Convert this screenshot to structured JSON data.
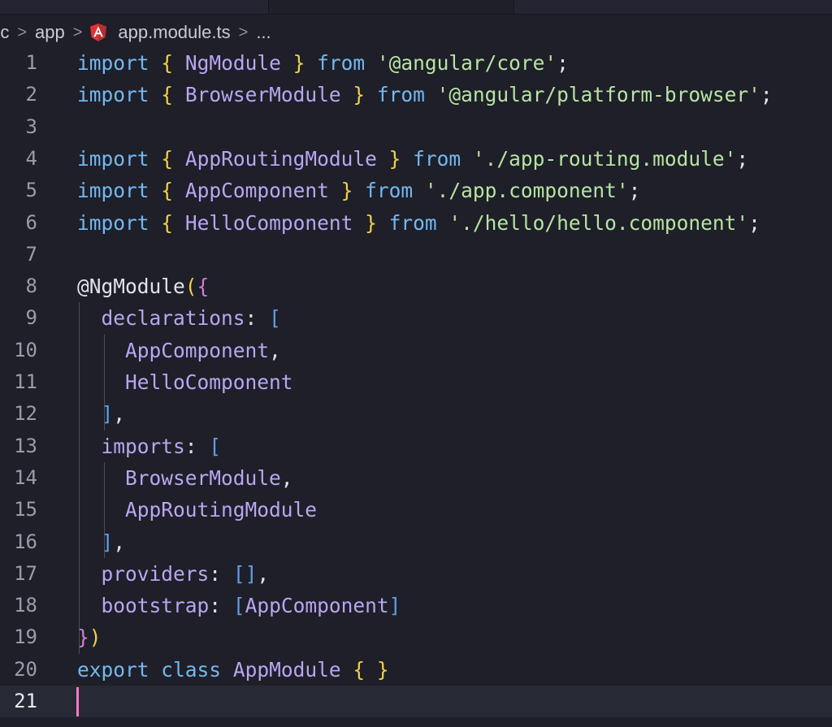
{
  "breadcrumb": {
    "items": [
      "rc",
      "app",
      "app.module.ts",
      "..."
    ],
    "separator": ">",
    "file_icon": "angular-icon"
  },
  "editor": {
    "language": "typescript",
    "active_line": 21,
    "theme_colors": {
      "background": "#1e1f28",
      "keyword": "#73b8f1",
      "bracket_level_1": "#f1d04a",
      "bracket_level_2": "#d37bd8",
      "bracket_level_3": "#5f9fea",
      "identifier": "#b9a6f2",
      "string": "#b7e4a3",
      "cursor": "#ff79c6"
    },
    "lines": [
      {
        "n": "1",
        "text": "import { NgModule } from '@angular/core';"
      },
      {
        "n": "2",
        "text": "import { BrowserModule } from '@angular/platform-browser';"
      },
      {
        "n": "3",
        "text": ""
      },
      {
        "n": "4",
        "text": "import { AppRoutingModule } from './app-routing.module';"
      },
      {
        "n": "5",
        "text": "import { AppComponent } from './app.component';"
      },
      {
        "n": "6",
        "text": "import { HelloComponent } from './hello/hello.component';"
      },
      {
        "n": "7",
        "text": ""
      },
      {
        "n": "8",
        "text": "@NgModule({"
      },
      {
        "n": "9",
        "text": "  declarations: ["
      },
      {
        "n": "10",
        "text": "    AppComponent,"
      },
      {
        "n": "11",
        "text": "    HelloComponent"
      },
      {
        "n": "12",
        "text": "  ],"
      },
      {
        "n": "13",
        "text": "  imports: ["
      },
      {
        "n": "14",
        "text": "    BrowserModule,"
      },
      {
        "n": "15",
        "text": "    AppRoutingModule"
      },
      {
        "n": "16",
        "text": "  ],"
      },
      {
        "n": "17",
        "text": "  providers: [],"
      },
      {
        "n": "18",
        "text": "  bootstrap: [AppComponent]"
      },
      {
        "n": "19",
        "text": "})"
      },
      {
        "n": "20",
        "text": "export class AppModule { }"
      },
      {
        "n": "21",
        "text": ""
      }
    ]
  }
}
